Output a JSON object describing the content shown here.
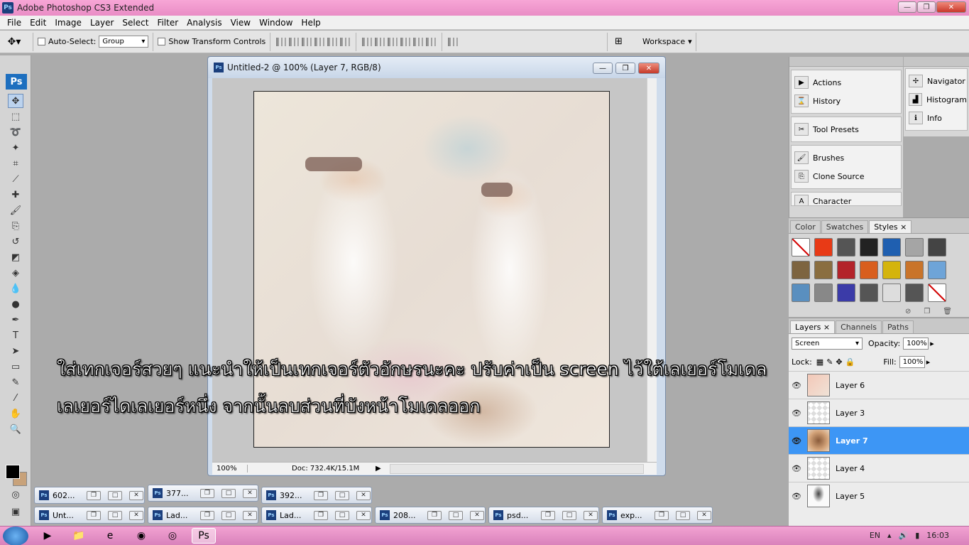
{
  "window": {
    "title": "Adobe Photoshop CS3 Extended",
    "app_icon": "Ps",
    "minimize": "—",
    "maximize": "❐",
    "close": "✕"
  },
  "menu": [
    "File",
    "Edit",
    "Image",
    "Layer",
    "Select",
    "Filter",
    "Analysis",
    "View",
    "Window",
    "Help"
  ],
  "options": {
    "auto_select_label": "Auto-Select:",
    "auto_select_value": "Group",
    "show_transform_label": "Show Transform Controls",
    "workspace_label": "Workspace"
  },
  "toolbox": {
    "logo": "Ps"
  },
  "document": {
    "title": "Untitled-2 @ 100% (Layer 7, RGB/8)",
    "zoom": "100%",
    "doc_info": "Doc: 732.4K/15.1M"
  },
  "caption": {
    "line1": "ใส่เทกเจอร์สวยๆ แนะนำให้เป็นเทกเจอร์ตัวอักษรนะคะ ปรับค่าเป็น screen ไว้ใต้เลเยอร์โมเดล",
    "line2": "เลเยอร์ไดเลเยอร์หนึ่ง จากนั้นลบส่วนที่บังหน้าโมเดลออก"
  },
  "dock_left": {
    "groups": [
      [
        {
          "label": "Actions",
          "icon": "▶"
        },
        {
          "label": "History",
          "icon": "⌛"
        }
      ],
      [
        {
          "label": "Tool Presets",
          "icon": "✂"
        }
      ],
      [
        {
          "label": "Brushes",
          "icon": "🖌"
        },
        {
          "label": "Clone Source",
          "icon": "⎘"
        }
      ],
      [
        {
          "label": "Character",
          "icon": "A"
        }
      ]
    ]
  },
  "dock_right": {
    "items": [
      {
        "label": "Navigator",
        "icon": "✢"
      },
      {
        "label": "Histogram",
        "icon": "▟"
      },
      {
        "label": "Info",
        "icon": "ℹ"
      }
    ]
  },
  "styles_panel": {
    "tabs": [
      "Color",
      "Swatches",
      "Styles ×"
    ],
    "swatches": [
      "#ffffff",
      "#e83a16",
      "#555555",
      "#222222",
      "#1f5fb0",
      "#a5a5a5",
      "#444444",
      "#7d6440",
      "#8a6e40",
      "#b3232a",
      "#d85e1e",
      "#d4b40c",
      "#c9742a",
      "#6ea4d8",
      "#5a8fbf",
      "#888888",
      "#3b3ba8",
      "#555555",
      "#dddddd",
      "#555555",
      "#ffffff"
    ]
  },
  "layers_panel": {
    "tabs": [
      "Layers ×",
      "Channels",
      "Paths"
    ],
    "blend_mode": "Screen",
    "opacity_label": "Opacity:",
    "opacity": "100%",
    "lock_label": "Lock:",
    "fill_label": "Fill:",
    "fill": "100%",
    "layers": [
      {
        "name": "Layer 6",
        "thumb": "l6",
        "selected": false
      },
      {
        "name": "Layer 3",
        "thumb": "",
        "selected": false
      },
      {
        "name": "Layer 7",
        "thumb": "l7",
        "selected": true
      },
      {
        "name": "Layer 4",
        "thumb": "",
        "selected": false
      },
      {
        "name": "Layer 5",
        "thumb": "l5",
        "selected": false
      }
    ]
  },
  "minimized_docs": [
    "602...",
    "377...",
    "392...",
    "Unt...",
    "Lad...",
    "Lad...",
    "208...",
    "psd...",
    "exp..."
  ],
  "taskbar": {
    "lang": "EN",
    "time": "16:03"
  }
}
